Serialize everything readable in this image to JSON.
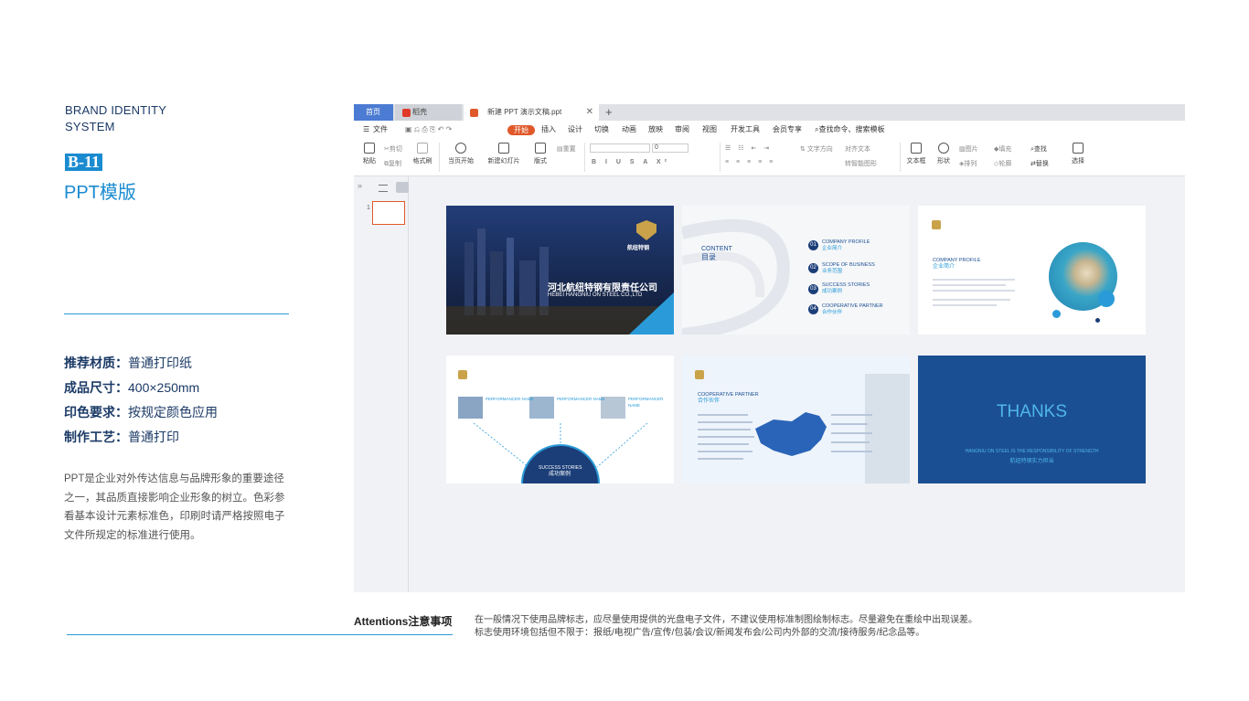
{
  "left": {
    "brand_line1": "BRAND IDENTITY",
    "brand_line2": "SYSTEM",
    "code": "B-11",
    "title": "PPT模版",
    "specs": [
      {
        "label": "推荐材质：",
        "value": "普通打印纸"
      },
      {
        "label": "成品尺寸：",
        "value": "400×250mm"
      },
      {
        "label": "印色要求：",
        "value": "按规定颜色应用"
      },
      {
        "label": "制作工艺：",
        "value": "普通打印"
      }
    ],
    "description": "PPT是企业对外传达信息与品牌形象的重要途径之一，其品质直接影响企业形象的树立。色彩参看基本设计元素标准色，印刷时请严格按照电子文件所规定的标准进行使用。"
  },
  "app": {
    "tabs": {
      "home": "首页",
      "docer": "稻壳",
      "doc": "新建 PPT 演示文稿.ppt",
      "close": "✕",
      "new": "+"
    },
    "menu": [
      "文件",
      "开始",
      "插入",
      "设计",
      "切换",
      "动画",
      "放映",
      "审阅",
      "视图",
      "开发工具",
      "会员专享"
    ],
    "search": "查找命令、搜索模板",
    "ribbon": {
      "paste": "粘贴",
      "cut": "剪切",
      "copy": "复制",
      "format_painter": "格式刷",
      "play": "当页开始",
      "new_slide": "新建幻灯片",
      "layout": "版式",
      "reset": "重置",
      "font_size": "0",
      "text_dir": "文字方向",
      "align_text": "对齐文本",
      "smartart": "转智能图形",
      "textbox": "文本框",
      "shape": "形状",
      "picture": "图片",
      "arrange": "排列",
      "fill": "填充",
      "outline": "轮廓",
      "find": "查找",
      "replace": "替换",
      "select": "选择"
    },
    "thumb_number": "1"
  },
  "slides": {
    "s1": {
      "logo": "航纽特钢",
      "logo_en": "HANGNIU ON STEEL",
      "company_cn": "河北航纽特钢有限责任公司",
      "company_en": "HEBEI HANGNIU ON STEEL CO.,LTD"
    },
    "s2": {
      "content_en": "CONTENT",
      "content_cn": "目录",
      "items": [
        {
          "no": "01",
          "en": "COMPANY PROFILE",
          "cn": "企业简介"
        },
        {
          "no": "02",
          "en": "SCOPE OF BUSINESS",
          "cn": "业务范围"
        },
        {
          "no": "03",
          "en": "SUCCESS STORIES",
          "cn": "成功案例"
        },
        {
          "no": "04",
          "en": "COOPERATIVE PARTNER",
          "cn": "合作伙伴"
        }
      ]
    },
    "s3": {
      "en": "COMPANY PROFILE",
      "cn": "企业简介"
    },
    "s4": {
      "perf": "PERFORMANCER NAME",
      "center_en": "SUCCESS STORIES",
      "center_cn": "成功案例"
    },
    "s5": {
      "en": "COOPERATIVE PARTNER",
      "cn": "合作伙伴"
    },
    "s6": {
      "thanks": "THANKS",
      "en": "HANGNIU ON STEEL IS THE RESPONSIBILITY OF STRENGTH",
      "cn": "航纽特钢实力担当"
    }
  },
  "footer": {
    "attention": "Attentions注意事项",
    "line1": "在一般情况下使用品牌标志，应尽量使用提供的光盘电子文件，不建议使用标准制图绘制标志。尽量避免在重绘中出现误差。",
    "line2": "标志使用环境包括但不限于：报纸/电视广告/宣传/包装/会议/新闻发布会/公司内外部的交流/接待服务/纪念品等。"
  }
}
